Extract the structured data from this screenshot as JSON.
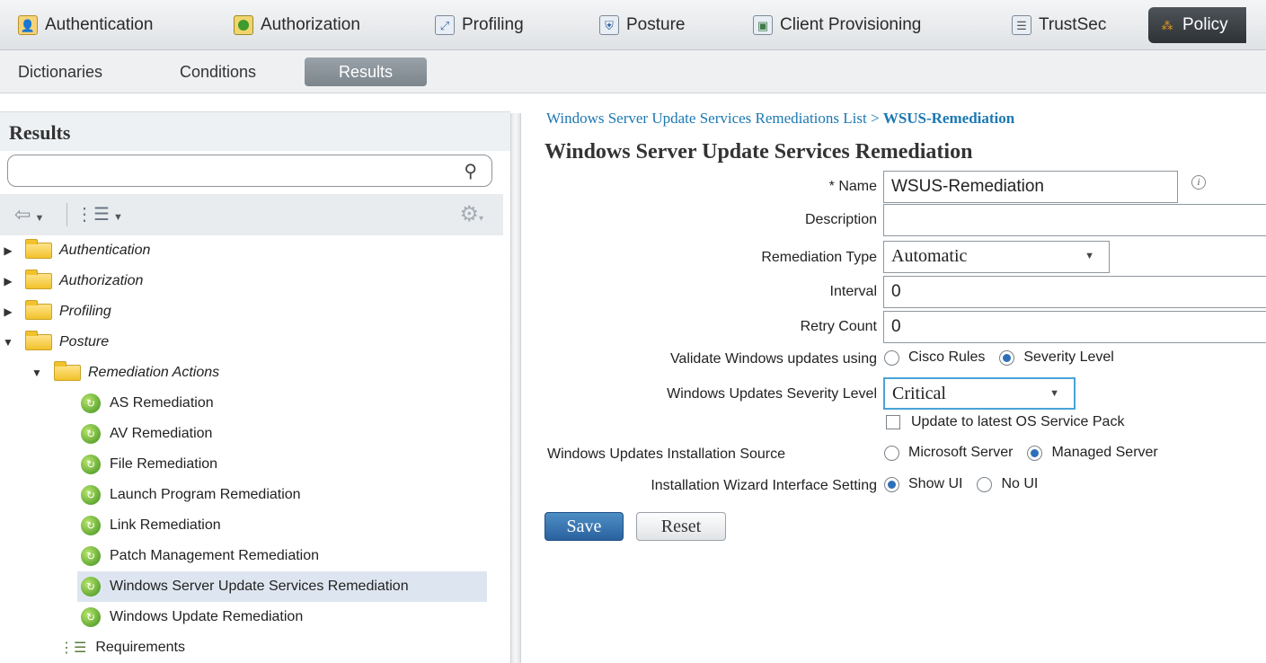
{
  "top_menu": {
    "items": [
      {
        "label": "Authentication",
        "icon": "authentication-icon"
      },
      {
        "label": "Authorization",
        "icon": "authorization-icon"
      },
      {
        "label": "Profiling",
        "icon": "profiling-icon"
      },
      {
        "label": "Posture",
        "icon": "posture-icon"
      },
      {
        "label": "Client Provisioning",
        "icon": "client-provisioning-icon"
      },
      {
        "label": "TrustSec",
        "icon": "trustsec-icon"
      },
      {
        "label": "Policy",
        "icon": "policy-icon",
        "active": true
      }
    ]
  },
  "sub_menu": {
    "items": [
      {
        "label": "Dictionaries"
      },
      {
        "label": "Conditions"
      },
      {
        "label": "Results",
        "active": true
      }
    ]
  },
  "left_panel": {
    "title": "Results",
    "search": {
      "value": "",
      "placeholder": ""
    },
    "tree": [
      {
        "label": "Authentication",
        "type": "folder",
        "expanded": false,
        "level": 0
      },
      {
        "label": "Authorization",
        "type": "folder",
        "expanded": false,
        "level": 0
      },
      {
        "label": "Profiling",
        "type": "folder",
        "expanded": false,
        "level": 0
      },
      {
        "label": "Posture",
        "type": "folder",
        "expanded": true,
        "level": 0
      },
      {
        "label": "Remediation Actions",
        "type": "folder",
        "expanded": true,
        "level": 1
      },
      {
        "label": "AS Remediation",
        "type": "item",
        "level": 2
      },
      {
        "label": "AV Remediation",
        "type": "item",
        "level": 2
      },
      {
        "label": "File Remediation",
        "type": "item",
        "level": 2
      },
      {
        "label": "Launch Program Remediation",
        "type": "item",
        "level": 2
      },
      {
        "label": "Link Remediation",
        "type": "item",
        "level": 2
      },
      {
        "label": "Patch Management Remediation",
        "type": "item",
        "level": 2
      },
      {
        "label": "Windows Server Update Services Remediation",
        "type": "item",
        "level": 2,
        "selected": true
      },
      {
        "label": "Windows Update Remediation",
        "type": "item",
        "level": 2
      },
      {
        "label": "Requirements",
        "type": "requirements",
        "level": 1
      }
    ]
  },
  "form": {
    "breadcrumb_list": "Windows Server Update Services Remediations List",
    "breadcrumb_sep": " > ",
    "breadcrumb_current": "WSUS-Remediation",
    "title": "Windows Server Update Services Remediation",
    "name_label": "* Name",
    "name_value": "WSUS-Remediation",
    "description_label": "Description",
    "description_value": "",
    "remediation_type_label": "Remediation Type",
    "remediation_type_value": "Automatic",
    "interval_label": "Interval",
    "interval_value": "0",
    "retry_count_label": "Retry Count",
    "retry_count_value": "0",
    "validate_label": "Validate Windows updates using",
    "validate_option_cisco": "Cisco Rules",
    "validate_option_severity": "Severity Level",
    "validate_selected": "Severity Level",
    "severity_label": "Windows Updates Severity Level",
    "severity_value": "Critical",
    "update_os_sp_label": "Update to latest OS Service Pack",
    "update_os_sp_checked": false,
    "install_source_label": "Windows Updates Installation Source",
    "install_source_microsoft": "Microsoft Server",
    "install_source_managed": "Managed Server",
    "install_source_selected": "Managed Server",
    "wizard_label": "Installation Wizard Interface Setting",
    "wizard_show_ui": "Show UI",
    "wizard_no_ui": "No UI",
    "wizard_selected": "Show UI",
    "save_label": "Save",
    "reset_label": "Reset"
  }
}
